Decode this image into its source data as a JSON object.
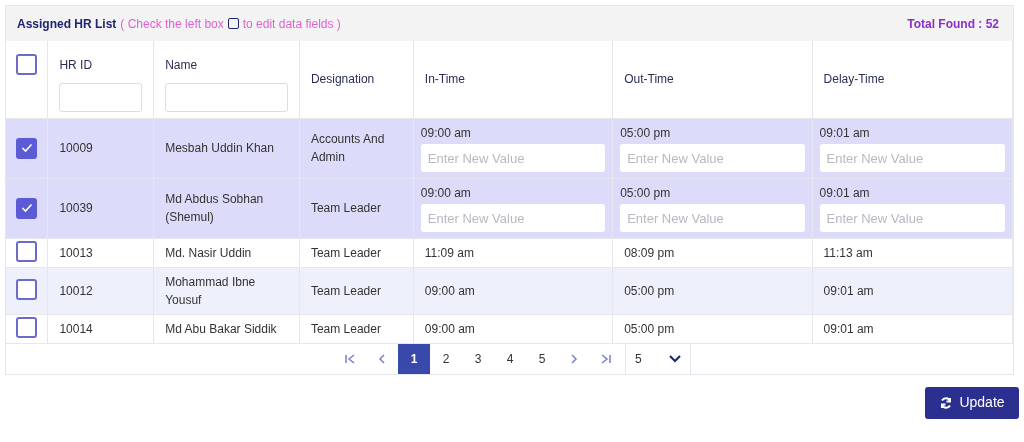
{
  "header": {
    "title": "Assigned HR List",
    "hint_before": "( Check the left box",
    "hint_after": "to edit data fields )",
    "total": "Total Found : 52"
  },
  "table": {
    "select_all": {
      "checked": false
    },
    "columns": [
      {
        "label": "HR ID",
        "filter": true
      },
      {
        "label": "Name",
        "filter": true
      },
      {
        "label": "Designation",
        "filter": false
      },
      {
        "label": "In-Time",
        "filter": false
      },
      {
        "label": "Out-Time",
        "filter": false
      },
      {
        "label": "Delay-Time",
        "filter": false
      }
    ],
    "rows": [
      {
        "checked": true,
        "hr_id": "10009",
        "name": "Mesbah Uddin Khan",
        "designation": "Accounts And Admin",
        "in_time": "09:00 am",
        "out_time": "05:00 pm",
        "delay_time": "09:01 am",
        "placeholders": [
          "Enter New Value",
          "Enter New Value",
          "Enter New Value"
        ]
      },
      {
        "checked": true,
        "hr_id": "10039",
        "name": "Md Abdus Sobhan (Shemul)",
        "designation": "Team Leader",
        "in_time": "09:00 am",
        "out_time": "05:00 pm",
        "delay_time": "09:01 am",
        "placeholders": [
          "Enter New Value",
          "Enter New Value",
          "Enter New Value"
        ]
      },
      {
        "checked": false,
        "hr_id": "10013",
        "name": "Md. Nasir Uddin",
        "designation": "Team Leader",
        "in_time": "11:09 am",
        "out_time": "08:09 pm",
        "delay_time": "11:13 am"
      },
      {
        "checked": false,
        "hr_id": "10012",
        "name": "Mohammad Ibne Yousuf",
        "designation": "Team Leader",
        "in_time": "09:00 am",
        "out_time": "05:00 pm",
        "delay_time": "09:01 am"
      },
      {
        "checked": false,
        "hr_id": "10014",
        "name": "Md Abu Bakar Siddik",
        "designation": "Team Leader",
        "in_time": "09:00 am",
        "out_time": "05:00 pm",
        "delay_time": "09:01 am"
      }
    ]
  },
  "pagination": {
    "pages": [
      {
        "label": "1",
        "selected": true
      },
      {
        "label": "2",
        "selected": false
      },
      {
        "label": "3",
        "selected": false
      },
      {
        "label": "4",
        "selected": false
      },
      {
        "label": "5",
        "selected": false
      }
    ],
    "page_size": "5"
  },
  "update_button": "Update"
}
